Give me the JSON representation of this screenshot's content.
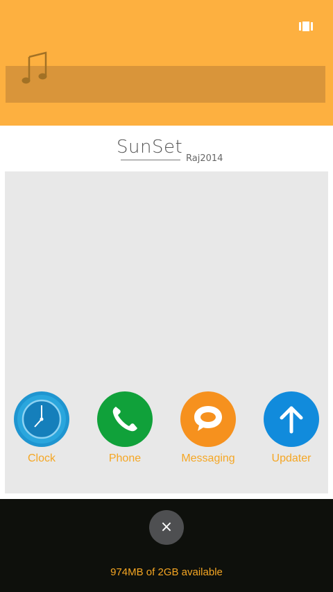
{
  "header": {
    "bg_color": "#fdb040",
    "recent_icon": "recent-apps-icon",
    "music_icon": "music-note-icon"
  },
  "logo": {
    "main": "SunSet",
    "sub": "Raj2014"
  },
  "apps": [
    {
      "label": "Clock",
      "icon": "clock-icon",
      "color": "#1f95d0"
    },
    {
      "label": "Phone",
      "icon": "phone-icon",
      "color": "#10a13a"
    },
    {
      "label": "Messaging",
      "icon": "chat-bubble-icon",
      "color": "#f6911e"
    },
    {
      "label": "Updater",
      "icon": "arrow-up-icon",
      "color": "#118bdc"
    }
  ],
  "close_button": {
    "glyph": "×"
  },
  "memory": {
    "text": "974MB of 2GB available"
  }
}
